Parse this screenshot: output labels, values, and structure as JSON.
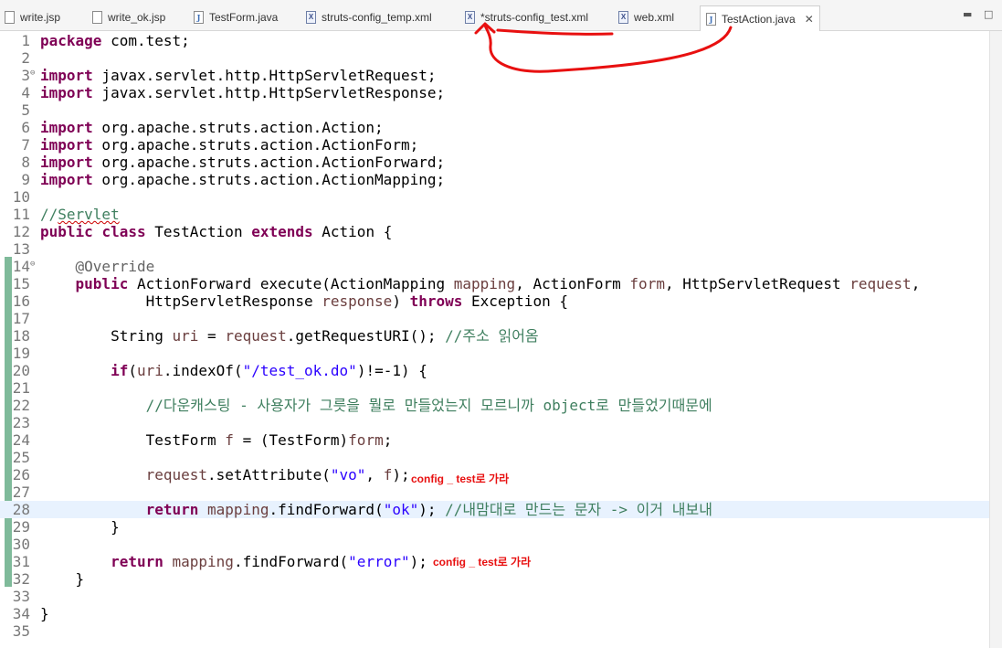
{
  "tabs": [
    {
      "name": "tab-write-jsp",
      "label": "write.jsp",
      "icon": "jsp-file-icon",
      "kind": "jsp",
      "active": false
    },
    {
      "name": "tab-write-ok-jsp",
      "label": "write_ok.jsp",
      "icon": "jsp-file-icon",
      "kind": "jsp",
      "active": false
    },
    {
      "name": "tab-testform-java",
      "label": "TestForm.java",
      "icon": "java-file-icon",
      "kind": "java",
      "active": false
    },
    {
      "name": "tab-struts-config-temp-xml",
      "label": "struts-config_temp.xml",
      "icon": "xml-file-icon",
      "kind": "xml",
      "active": false
    },
    {
      "name": "tab-struts-config-test-xml",
      "label": "*struts-config_test.xml",
      "icon": "xml-file-icon",
      "kind": "xml",
      "active": false
    },
    {
      "name": "tab-web-xml",
      "label": "web.xml",
      "icon": "xml-file-icon",
      "kind": "xml",
      "active": false
    },
    {
      "name": "tab-testaction-java",
      "label": "TestAction.java",
      "icon": "java-file-icon",
      "kind": "java",
      "active": true
    }
  ],
  "icons": {
    "tab_close": "close-icon",
    "minimize": "minimize-icon",
    "maximize": "maximize-icon",
    "fold": "fold-toggle-icon"
  },
  "glyphs": {
    "close": "✕",
    "minimize": "▬",
    "maximize": "□",
    "fold": "⊖",
    "java": "J",
    "xml": "X"
  },
  "colors": {
    "keyword": "#7f0055",
    "comment": "#3f7f5f",
    "string": "#2a00ff",
    "annotation": "#646464",
    "variable": "#6a3e3e",
    "highlight": "#e8f2fe",
    "red_mark": "#e81010",
    "change_bar": "#7fba9a"
  },
  "annotations": [
    {
      "name": "note-line-26",
      "text": "config _ test로 가라"
    },
    {
      "name": "note-line-31",
      "text": "config _ test로 가라"
    }
  ],
  "code_lines": [
    {
      "n": "1",
      "segs": [
        {
          "c": "kw",
          "t": "package"
        },
        {
          "c": "",
          "t": " com.test;"
        }
      ]
    },
    {
      "n": "2",
      "segs": []
    },
    {
      "n": "3",
      "fold": true,
      "segs": [
        {
          "c": "kw",
          "t": "import"
        },
        {
          "c": "",
          "t": " javax.servlet.http.HttpServletRequest;"
        }
      ]
    },
    {
      "n": "4",
      "segs": [
        {
          "c": "kw",
          "t": "import"
        },
        {
          "c": "",
          "t": " javax.servlet.http.HttpServletResponse;"
        }
      ]
    },
    {
      "n": "5",
      "segs": []
    },
    {
      "n": "6",
      "segs": [
        {
          "c": "kw",
          "t": "import"
        },
        {
          "c": "",
          "t": " org.apache.struts.action.Action;"
        }
      ]
    },
    {
      "n": "7",
      "segs": [
        {
          "c": "kw",
          "t": "import"
        },
        {
          "c": "",
          "t": " org.apache.struts.action.ActionForm;"
        }
      ]
    },
    {
      "n": "8",
      "segs": [
        {
          "c": "kw",
          "t": "import"
        },
        {
          "c": "",
          "t": " org.apache.struts.action.ActionForward;"
        }
      ]
    },
    {
      "n": "9",
      "segs": [
        {
          "c": "kw",
          "t": "import"
        },
        {
          "c": "",
          "t": " org.apache.struts.action.ActionMapping;"
        }
      ]
    },
    {
      "n": "10",
      "segs": []
    },
    {
      "n": "11",
      "segs": [
        {
          "c": "cm",
          "t": "//"
        },
        {
          "c": "cm squig",
          "t": "Servlet"
        }
      ]
    },
    {
      "n": "12",
      "segs": [
        {
          "c": "kw",
          "t": "public"
        },
        {
          "c": "",
          "t": " "
        },
        {
          "c": "kw",
          "t": "class"
        },
        {
          "c": "",
          "t": " TestAction "
        },
        {
          "c": "kw",
          "t": "extends"
        },
        {
          "c": "",
          "t": " Action {"
        }
      ]
    },
    {
      "n": "13",
      "segs": []
    },
    {
      "n": "14",
      "fold": true,
      "segs": [
        {
          "c": "",
          "t": "    "
        },
        {
          "c": "an",
          "t": "@Override"
        }
      ]
    },
    {
      "n": "15",
      "segs": [
        {
          "c": "",
          "t": "    "
        },
        {
          "c": "kw",
          "t": "public"
        },
        {
          "c": "",
          "t": " ActionForward execute(ActionMapping "
        },
        {
          "c": "vr",
          "t": "mapping"
        },
        {
          "c": "",
          "t": ", ActionForm "
        },
        {
          "c": "vr",
          "t": "form"
        },
        {
          "c": "",
          "t": ", HttpServletRequest "
        },
        {
          "c": "vr",
          "t": "request"
        },
        {
          "c": "",
          "t": ","
        }
      ]
    },
    {
      "n": "16",
      "segs": [
        {
          "c": "",
          "t": "            HttpServletResponse "
        },
        {
          "c": "vr",
          "t": "response"
        },
        {
          "c": "",
          "t": ") "
        },
        {
          "c": "kw",
          "t": "throws"
        },
        {
          "c": "",
          "t": " Exception {"
        }
      ]
    },
    {
      "n": "17",
      "segs": []
    },
    {
      "n": "18",
      "segs": [
        {
          "c": "",
          "t": "        String "
        },
        {
          "c": "vr",
          "t": "uri"
        },
        {
          "c": "",
          "t": " = "
        },
        {
          "c": "vr",
          "t": "request"
        },
        {
          "c": "",
          "t": ".getRequestURI(); "
        },
        {
          "c": "cm",
          "t": "//주소 읽어옴"
        }
      ]
    },
    {
      "n": "19",
      "segs": []
    },
    {
      "n": "20",
      "segs": [
        {
          "c": "",
          "t": "        "
        },
        {
          "c": "kw",
          "t": "if"
        },
        {
          "c": "",
          "t": "("
        },
        {
          "c": "vr",
          "t": "uri"
        },
        {
          "c": "",
          "t": ".indexOf("
        },
        {
          "c": "st",
          "t": "\"/test_ok.do\""
        },
        {
          "c": "",
          "t": ")!=-1) {"
        }
      ]
    },
    {
      "n": "21",
      "segs": []
    },
    {
      "n": "22",
      "segs": [
        {
          "c": "",
          "t": "            "
        },
        {
          "c": "cm",
          "t": "//다운캐스팅 - 사용자가 그릇을 뭘로 만들었는지 모르니까 object로 만들었기때문에"
        }
      ]
    },
    {
      "n": "23",
      "segs": []
    },
    {
      "n": "24",
      "segs": [
        {
          "c": "",
          "t": "            TestForm "
        },
        {
          "c": "vr",
          "t": "f"
        },
        {
          "c": "",
          "t": " = (TestForm)"
        },
        {
          "c": "vr",
          "t": "form"
        },
        {
          "c": "",
          "t": ";"
        }
      ]
    },
    {
      "n": "25",
      "segs": []
    },
    {
      "n": "26",
      "segs": [
        {
          "c": "",
          "t": "            "
        },
        {
          "c": "vr",
          "t": "request"
        },
        {
          "c": "",
          "t": ".setAttribute("
        },
        {
          "c": "st",
          "t": "\"vo\""
        },
        {
          "c": "",
          "t": ", "
        },
        {
          "c": "vr",
          "t": "f"
        },
        {
          "c": "",
          "t": ");"
        }
      ]
    },
    {
      "n": "27",
      "segs": []
    },
    {
      "n": "28",
      "hl": true,
      "segs": [
        {
          "c": "",
          "t": "            "
        },
        {
          "c": "kw",
          "t": "return"
        },
        {
          "c": "",
          "t": " "
        },
        {
          "c": "vr",
          "t": "mapping"
        },
        {
          "c": "",
          "t": ".findForward("
        },
        {
          "c": "st",
          "t": "\"ok\""
        },
        {
          "c": "",
          "t": "); "
        },
        {
          "c": "cm",
          "t": "//내맘대로 만드는 문자 -> 이거 내보내"
        }
      ]
    },
    {
      "n": "29",
      "segs": [
        {
          "c": "",
          "t": "        }"
        }
      ]
    },
    {
      "n": "30",
      "segs": []
    },
    {
      "n": "31",
      "segs": [
        {
          "c": "",
          "t": "        "
        },
        {
          "c": "kw",
          "t": "return"
        },
        {
          "c": "",
          "t": " "
        },
        {
          "c": "vr",
          "t": "mapping"
        },
        {
          "c": "",
          "t": ".findForward("
        },
        {
          "c": "st",
          "t": "\"error\""
        },
        {
          "c": "",
          "t": ");"
        }
      ]
    },
    {
      "n": "32",
      "segs": [
        {
          "c": "",
          "t": "    }"
        }
      ]
    },
    {
      "n": "33",
      "segs": []
    },
    {
      "n": "34",
      "segs": [
        {
          "c": "",
          "t": "}"
        }
      ]
    },
    {
      "n": "35",
      "segs": []
    }
  ]
}
